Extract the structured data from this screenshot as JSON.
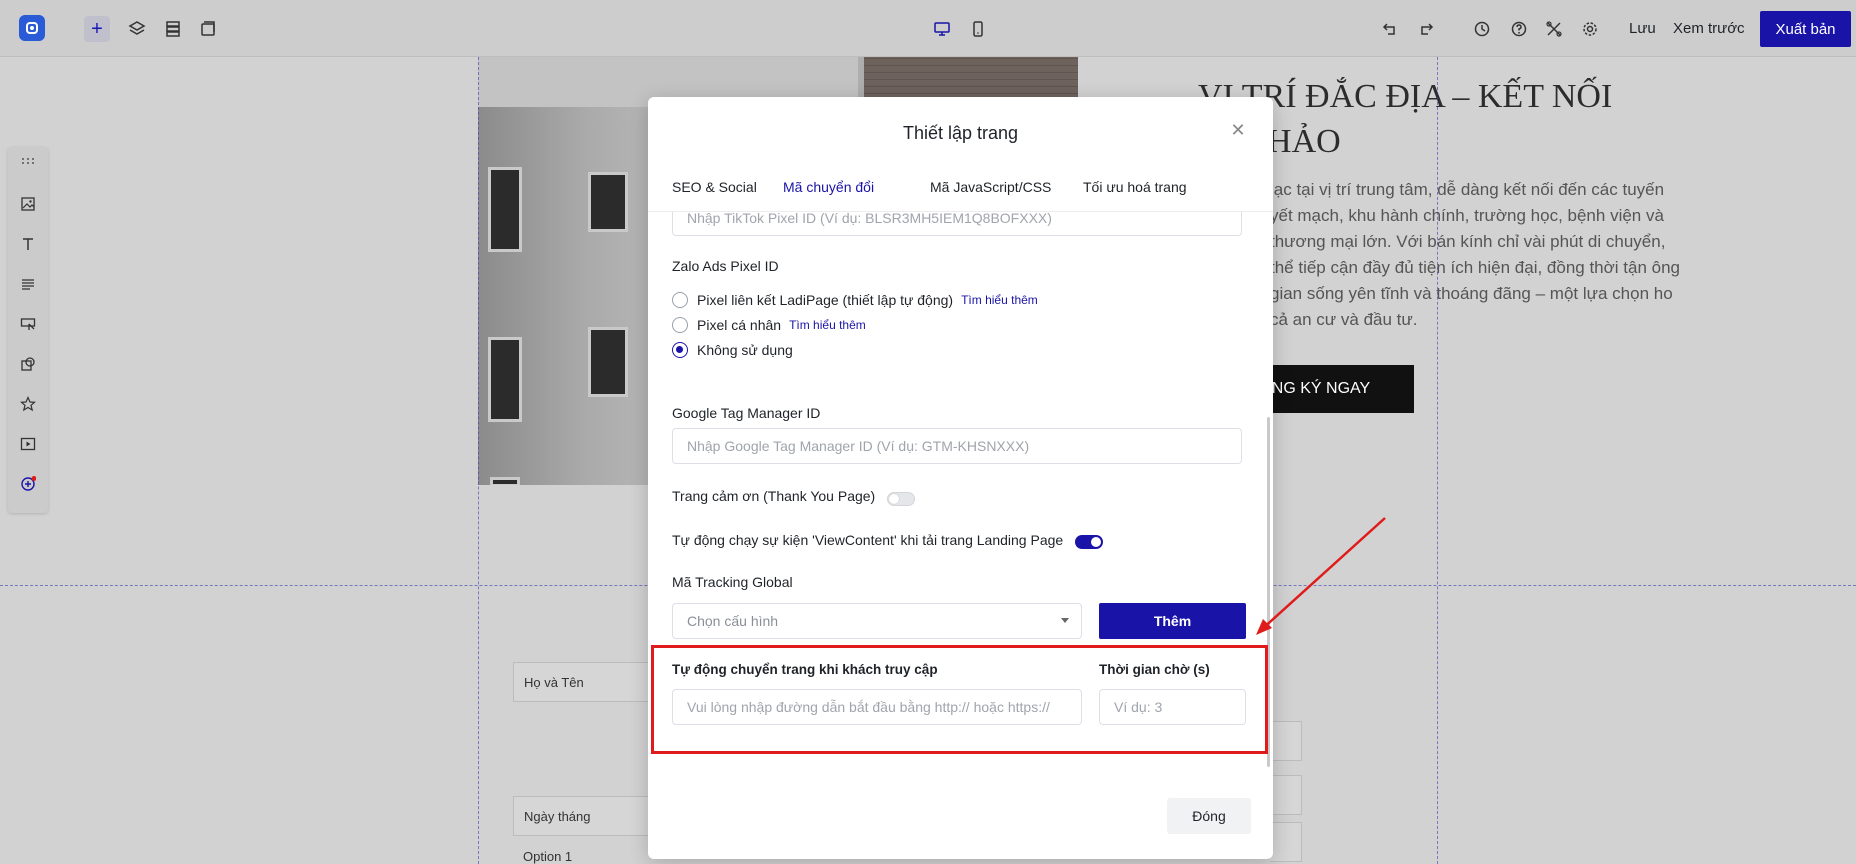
{
  "topbar": {
    "save_label": "Lưu",
    "preview_label": "Xem trước",
    "publish_label": "Xuất bản"
  },
  "background": {
    "hero_title_line1": "VỊ TRÍ ĐẮC ĐỊA – KẾT NỐI",
    "hero_title_line2": "N HẢO",
    "hero_text": "lạc tại vị trí trung tâm, dễ dàng kết nối đến các tuyến yết mạch, khu hành chính, trường học, bệnh viện và thương mại lớn. Với bán kính chỉ vài phút di chuyển, thể tiếp cận đầy đủ tiện ích hiện đại, đồng thời tận ông gian sống yên tĩnh và thoáng đãng – một lựa chọn ho cả an cư và đầu tư.",
    "hero_cta": "NG KÝ NGAY",
    "form_name_label": "Họ và Tên",
    "form_date_label": "Ngày tháng",
    "form_option_label": "Option 1"
  },
  "modal": {
    "title": "Thiết lập trang",
    "tabs": [
      {
        "label": "SEO & Social",
        "active": false
      },
      {
        "label": "Mã chuyển đổi",
        "active": true
      },
      {
        "label": "Mã JavaScript/CSS",
        "active": false
      },
      {
        "label": "Tối ưu hoá trang",
        "active": false
      }
    ],
    "tiktok_placeholder": "Nhập TikTok Pixel ID (Ví dụ: BLSR3MH5IEM1Q8BOFXXX)",
    "zalo": {
      "label": "Zalo Ads Pixel ID",
      "options": [
        {
          "label": "Pixel liên kết LadiPage (thiết lập tự động)",
          "link": "Tìm hiểu thêm",
          "checked": false
        },
        {
          "label": "Pixel cá nhân",
          "link": "Tìm hiểu thêm",
          "checked": false
        },
        {
          "label": "Không sử dụng",
          "link": "",
          "checked": true
        }
      ]
    },
    "gtm": {
      "label": "Google Tag Manager ID",
      "placeholder": "Nhập Google Tag Manager ID (Ví dụ: GTM-KHSNXXX)"
    },
    "thank_you": {
      "label": "Trang cảm ơn (Thank You Page)",
      "enabled": false
    },
    "view_content": {
      "label": "Tự động chạy sự kiện 'ViewContent' khi tải trang Landing Page",
      "enabled": true
    },
    "tracking": {
      "label": "Mã Tracking Global",
      "select_value": "Chọn cấu hình",
      "add_label": "Thêm"
    },
    "redirect": {
      "label": "Tự động chuyển trang khi khách truy cập",
      "placeholder": "Vui lòng nhập đường dẫn bắt đầu bằng http:// hoặc https://"
    },
    "wait_time": {
      "label": "Thời gian chờ (s)",
      "placeholder": "Ví dụ: 3"
    },
    "close_label": "Đóng"
  },
  "colors": {
    "accent": "#1a13a8",
    "annotation": "#e01b1b"
  }
}
